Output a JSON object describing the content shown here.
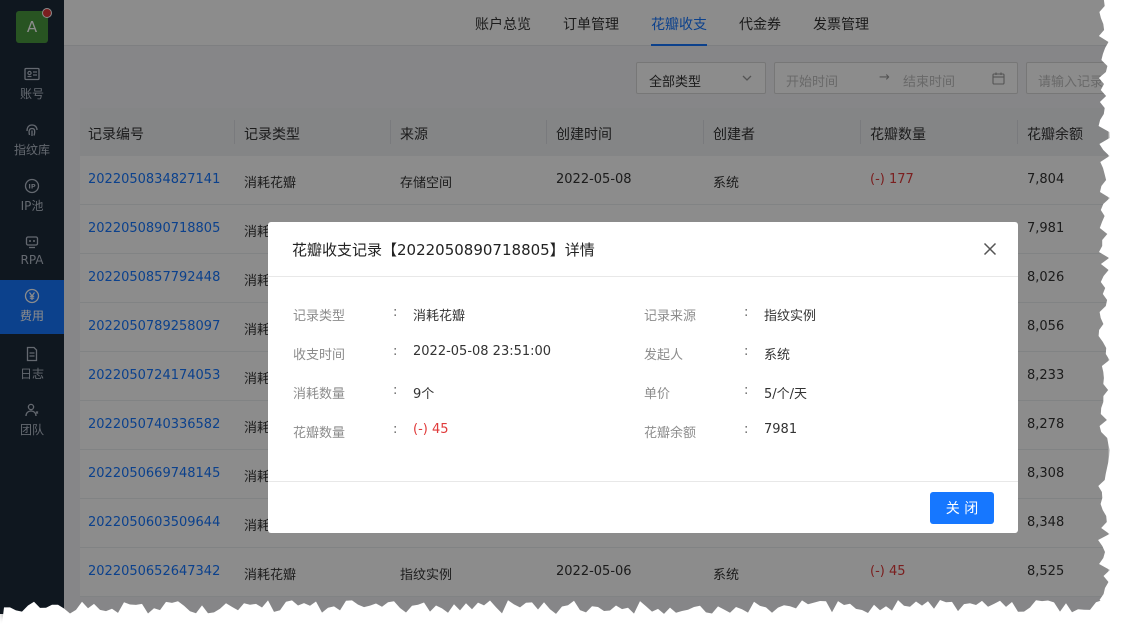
{
  "sidebar": {
    "logo_letter": "A",
    "items": [
      {
        "label": "账号",
        "icon": "id-card-icon"
      },
      {
        "label": "指纹库",
        "icon": "fingerprint-icon"
      },
      {
        "label": "IP池",
        "icon": "ip-icon"
      },
      {
        "label": "RPA",
        "icon": "robot-icon"
      },
      {
        "label": "费用",
        "icon": "yen-icon",
        "active": true
      },
      {
        "label": "日志",
        "icon": "document-icon"
      },
      {
        "label": "团队",
        "icon": "team-icon"
      }
    ]
  },
  "tabs": [
    "账户总览",
    "订单管理",
    "花瓣收支",
    "代金券",
    "发票管理"
  ],
  "active_tab": "花瓣收支",
  "filters": {
    "type_select": "全部类型",
    "start_placeholder": "开始时间",
    "arrow": "→",
    "end_placeholder": "结束时间",
    "search_placeholder": "请输入记录"
  },
  "table": {
    "columns": [
      "记录编号",
      "记录类型",
      "来源",
      "创建时间",
      "创建者",
      "花瓣数量",
      "花瓣余额"
    ],
    "rows": [
      {
        "id": "2022050834827141",
        "type": "消耗花瓣",
        "source": "存储空间",
        "created": "2022-05-08",
        "creator": "系统",
        "amount": "(-) 177",
        "balance": "7,804"
      },
      {
        "id": "2022050890718805",
        "type": "消耗",
        "source": "",
        "created": "",
        "creator": "",
        "amount": "",
        "balance": "7,981"
      },
      {
        "id": "2022050857792448",
        "type": "消耗",
        "source": "",
        "created": "",
        "creator": "",
        "amount": "",
        "balance": "8,026"
      },
      {
        "id": "2022050789258097",
        "type": "消耗",
        "source": "",
        "created": "",
        "creator": "",
        "amount": "",
        "balance": "8,056"
      },
      {
        "id": "2022050724174053",
        "type": "消耗",
        "source": "",
        "created": "",
        "creator": "",
        "amount": "",
        "balance": "8,233"
      },
      {
        "id": "2022050740336582",
        "type": "消耗",
        "source": "",
        "created": "",
        "creator": "",
        "amount": "",
        "balance": "8,278"
      },
      {
        "id": "2022050669748145",
        "type": "消耗",
        "source": "",
        "created": "",
        "creator": "",
        "amount": "",
        "balance": "8,308"
      },
      {
        "id": "2022050603509644",
        "type": "消耗",
        "source": "",
        "created": "",
        "creator": "",
        "amount": "",
        "balance": "8,348"
      },
      {
        "id": "2022050652647342",
        "type": "消耗花瓣",
        "source": "指纹实例",
        "created": "2022-05-06",
        "creator": "系统",
        "amount": "(-) 45",
        "balance": "8,525"
      }
    ]
  },
  "modal": {
    "title": "花瓣收支记录【2022050890718805】详情",
    "fields": [
      {
        "label": "记录类型",
        "value": "消耗花瓣"
      },
      {
        "label": "记录来源",
        "value": "指纹实例"
      },
      {
        "label": "收支时间",
        "value": "2022-05-08 23:51:00"
      },
      {
        "label": "发起人",
        "value": "系统"
      },
      {
        "label": "消耗数量",
        "value": "9个"
      },
      {
        "label": "单价",
        "value": "5/个/天"
      },
      {
        "label": "花瓣数量",
        "value": "(-) 45",
        "negative": true
      },
      {
        "label": "花瓣余额",
        "value": "7981"
      }
    ],
    "colon": ":",
    "close_button": "关 闭"
  },
  "colors": {
    "accent": "#1677ff",
    "negative": "#e03a3a",
    "sidebar_bg": "#1d2a3a",
    "logo_bg": "#4a9a3e"
  }
}
